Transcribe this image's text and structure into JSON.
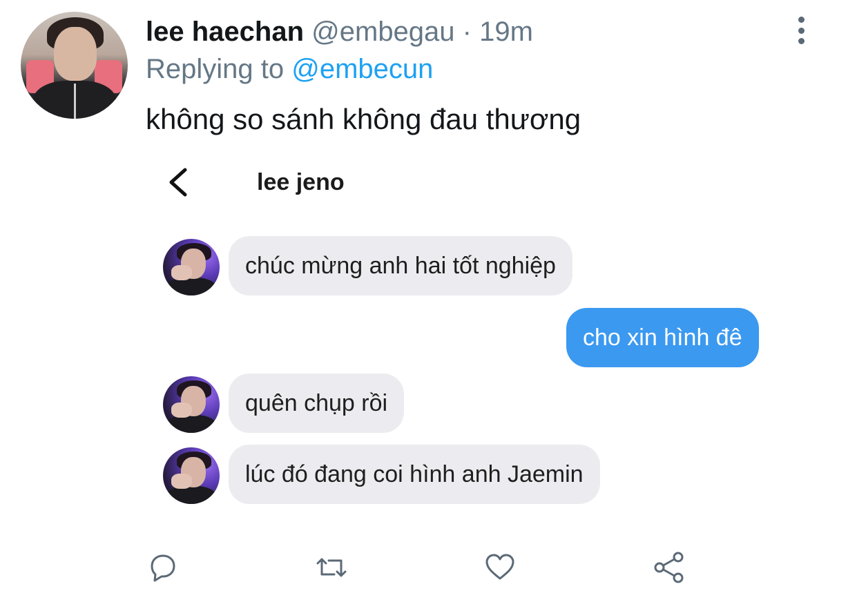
{
  "tweet": {
    "display_name": "lee haechan",
    "handle": "@embegau",
    "separator": "·",
    "time": "19m",
    "replying_prefix": "Replying to",
    "replying_handle": "@embecun",
    "text": "không so sánh không đau thương"
  },
  "dm": {
    "title": "lee jeno",
    "messages": [
      {
        "side": "incoming",
        "text": "chúc mừng anh hai tốt nghiệp"
      },
      {
        "side": "outgoing",
        "text": "cho xin hình đê"
      },
      {
        "side": "incoming",
        "text": "quên chụp rồi"
      },
      {
        "side": "incoming",
        "text": "lúc đó đang coi hình anh Jaemin"
      }
    ]
  },
  "actions": [
    "reply-icon",
    "retweet-icon",
    "like-icon",
    "share-icon"
  ],
  "colors": {
    "link": "#1da1f2",
    "muted": "#657786",
    "incoming_bubble": "#ececf0",
    "outgoing_bubble": "#3b99f0",
    "icon": "#5b6976"
  }
}
